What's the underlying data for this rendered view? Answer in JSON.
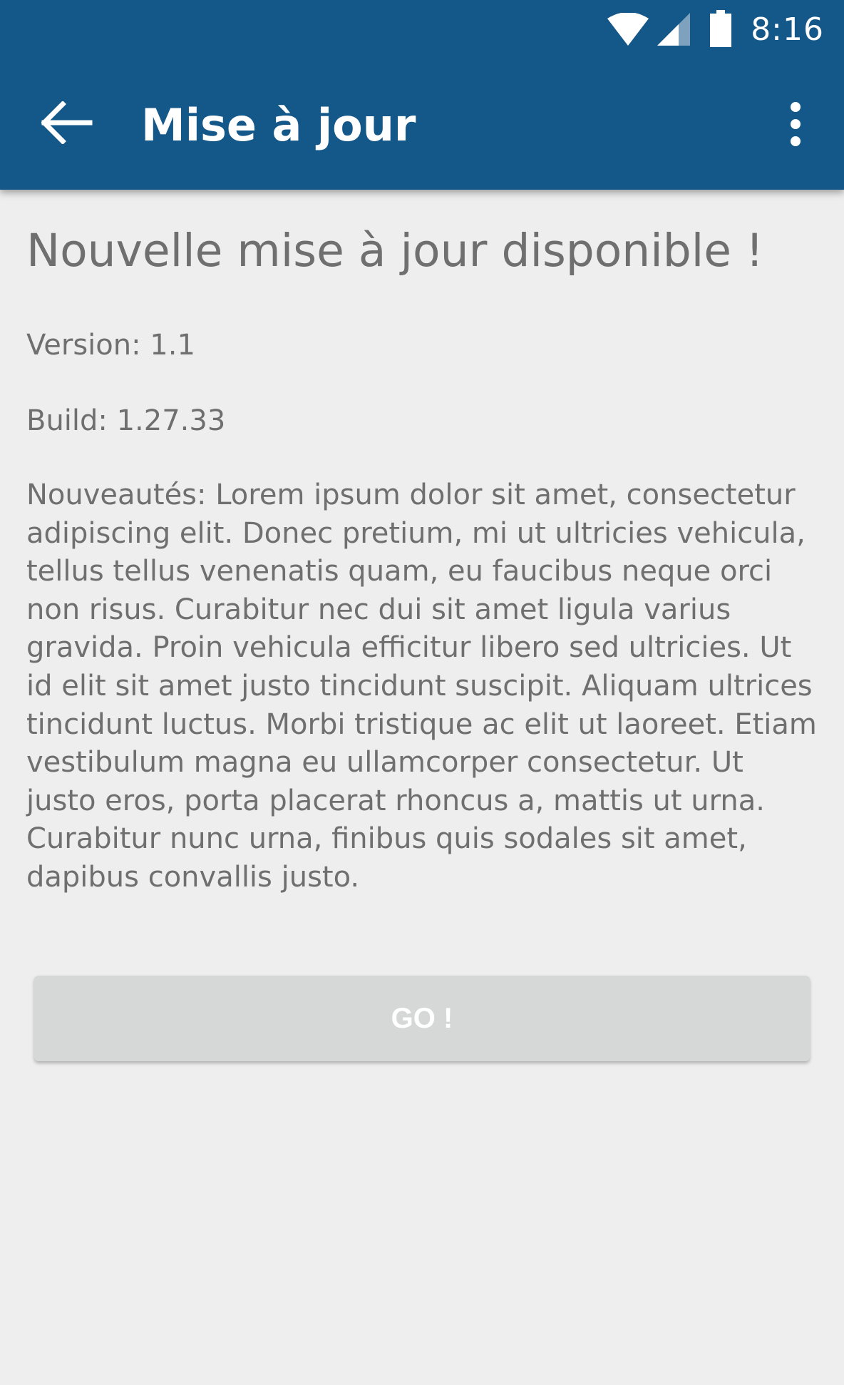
{
  "status_bar": {
    "time": "8:16",
    "icons": [
      "wifi-icon",
      "cell-signal-icon",
      "battery-icon"
    ]
  },
  "toolbar": {
    "title": "Mise à jour",
    "back_icon": "arrow-back-icon",
    "menu_icon": "more-vert-icon"
  },
  "content": {
    "heading": "Nouvelle mise à jour disponible !",
    "version": "Version: 1.1",
    "build": "Build: 1.27.33",
    "description": "Nouveautés:  Lorem ipsum dolor sit amet, consectetur adipiscing elit. Donec pretium, mi ut ultricies vehicula, tellus tellus venenatis quam, eu faucibus neque orci non risus. Curabitur nec dui sit amet ligula varius gravida. Proin vehicula efficitur libero sed ultricies. Ut id elit sit amet justo tincidunt suscipit. Aliquam ultrices tincidunt luctus. Morbi tristique ac elit ut laoreet. Etiam vestibulum magna eu ullamcorper consectetur. Ut justo eros, porta placerat rhoncus a, mattis ut urna. Curabitur nunc urna, finibus quis sodales sit amet, dapibus convallis justo."
  },
  "actions": {
    "go_label": "GO !"
  },
  "colors": {
    "app_bar": "#145789",
    "background": "#eeeeee",
    "text": "#6f6f6f",
    "button_disabled": "#d6d7d7"
  }
}
